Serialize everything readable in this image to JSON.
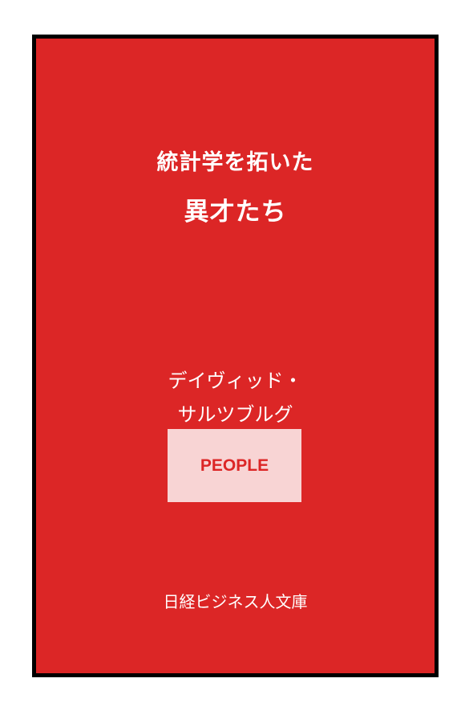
{
  "book": {
    "title_line1": "統計学を拓いた",
    "title_line2": "異才たち",
    "author_line1": "デイヴィッド・",
    "author_line2": "サルツブルグ",
    "badge_label": "PEOPLE",
    "publisher": "日経ビジネス人文庫"
  },
  "colors": {
    "cover_background": "#dc2626",
    "border": "#000000",
    "badge_background": "#f8d4d4",
    "badge_text": "#dc2626",
    "text": "#ffffff"
  }
}
